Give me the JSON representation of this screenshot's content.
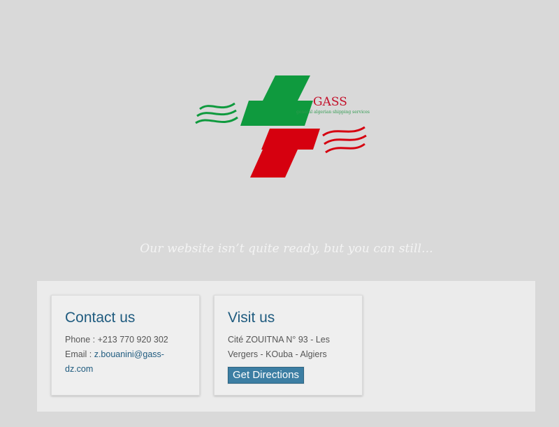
{
  "logo": {
    "name": "GASS",
    "subtitle": "general algerian shipping services"
  },
  "tagline": "Our website isn’t quite ready, but you can still...",
  "contact": {
    "title": "Contact us",
    "phone_label": "Phone : ",
    "phone": "+213 770 920 302",
    "email_label": "Email : ",
    "email_line1": "z.bouanini@gass-",
    "email_line2": "dz.com"
  },
  "visit": {
    "title": "Visit us",
    "address_line1": "Cité ZOUITNA N° 93 - Les",
    "address_line2": "Vergers - KOuba - Algiers",
    "button_label": "Get Directions"
  },
  "colors": {
    "green": "#0f9a3e",
    "red": "#d6000f",
    "accent": "#1f5b7f"
  }
}
